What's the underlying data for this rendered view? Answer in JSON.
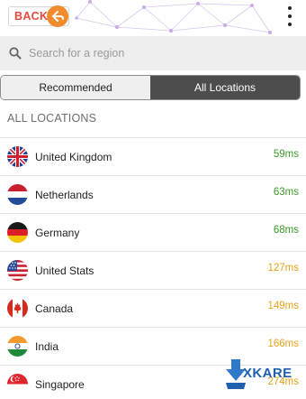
{
  "header": {
    "back_label": "BACK",
    "icons": {
      "back": "back-arrow-icon",
      "menu": "kebab-menu-icon"
    }
  },
  "search": {
    "placeholder": "Search for a region",
    "value": "",
    "icon": "search-icon"
  },
  "tabs": [
    {
      "label": "Recommended",
      "active": false
    },
    {
      "label": "All Locations",
      "active": true
    }
  ],
  "section_title": "ALL LOCATIONS",
  "locations": [
    {
      "name": "United Kingdom",
      "latency": "59ms",
      "flag": "uk-flag-icon",
      "latency_color": "#3a9a2a"
    },
    {
      "name": "Netherlands",
      "latency": "63ms",
      "flag": "netherlands-flag-icon",
      "latency_color": "#3a9a2a"
    },
    {
      "name": "Germany",
      "latency": "68ms",
      "flag": "germany-flag-icon",
      "latency_color": "#3a9a2a"
    },
    {
      "name": "United Stats",
      "latency": "127ms",
      "flag": "usa-flag-icon",
      "latency_color": "#e8a21a"
    },
    {
      "name": "Canada",
      "latency": "149ms",
      "flag": "canada-flag-icon",
      "latency_color": "#e8a21a"
    },
    {
      "name": "India",
      "latency": "166ms",
      "flag": "india-flag-icon",
      "latency_color": "#e8a21a"
    },
    {
      "name": "Singapore",
      "latency": "274ms",
      "flag": "singapore-flag-icon",
      "latency_color": "#e8a21a"
    }
  ],
  "watermark": {
    "text": "XKARE"
  },
  "colors": {
    "back_text": "#e8473c",
    "back_arrow": "#f28a2e",
    "tab_active_bg": "#4d4d4d",
    "good_latency": "#3a9a2a",
    "medium_latency": "#e8a21a",
    "watermark": "#1f5fb0"
  }
}
